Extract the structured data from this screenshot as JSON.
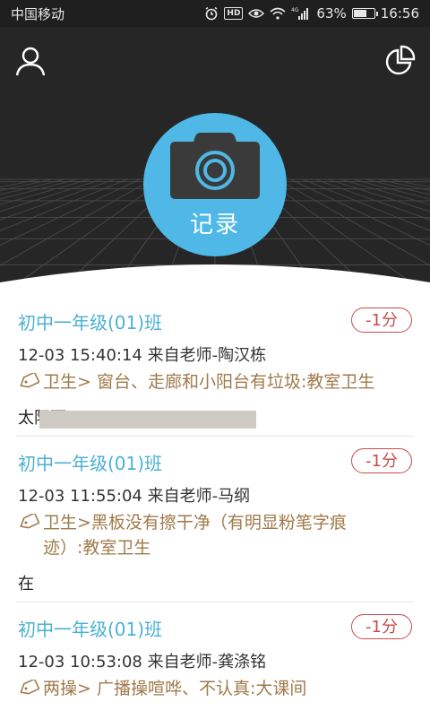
{
  "status_bar": {
    "carrier": "中国移动",
    "network_label": "4G",
    "hd_label": "HD",
    "battery_text": "63%",
    "battery_level": 0.63,
    "time": "16:56"
  },
  "header": {
    "record_label": "记录"
  },
  "feed": [
    {
      "class_name": "初中一年级(01)班",
      "score": "-1分",
      "meta": "12-03 15:40:14  来自老师-陶汉栋",
      "tag_line1": "卫生> 窗台、走廊和小阳台有垃圾:教室卫生",
      "tag_line2": "",
      "note": "太阳雨"
    },
    {
      "class_name": "初中一年级(01)班",
      "score": "-1分",
      "meta": "12-03 11:55:04  来自老师-马纲",
      "tag_line1": "卫生>黑板没有擦干净（有明显粉笔字痕",
      "tag_line2": "迹）:教室卫生",
      "note": "在"
    },
    {
      "class_name": "初中一年级(01)班",
      "score": "-1分",
      "meta": "12-03 10:53:08  来自老师-龚涤铭",
      "tag_line1": "两操> 广播操喧哗、不认真:大课间",
      "tag_line2": "",
      "note": ""
    }
  ]
}
